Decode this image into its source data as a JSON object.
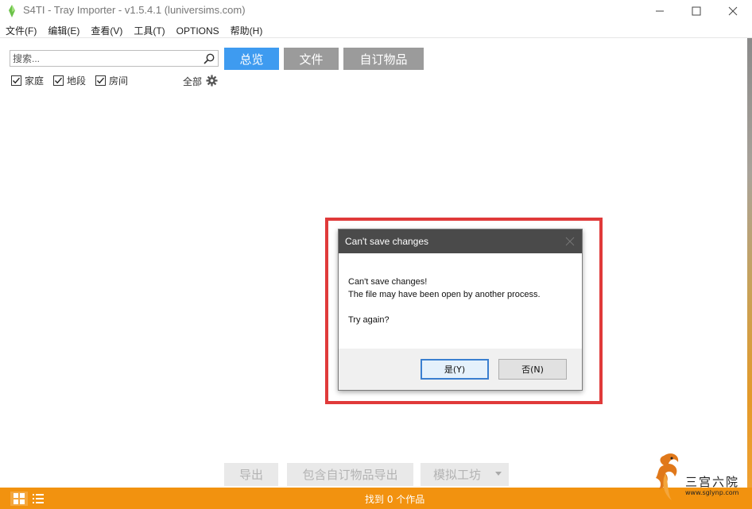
{
  "window": {
    "title": "S4TI - Tray Importer - v1.5.4.1  (luniversims.com)"
  },
  "menu": [
    "文件(F)",
    "编辑(E)",
    "查看(V)",
    "工具(T)",
    "OPTIONS",
    "帮助(H)"
  ],
  "search": {
    "placeholder": "搜索..."
  },
  "filters": {
    "items": [
      {
        "label": "家庭",
        "checked": true
      },
      {
        "label": "地段",
        "checked": true
      },
      {
        "label": "房间",
        "checked": true
      }
    ],
    "all_label": "全部"
  },
  "tabs": [
    {
      "label": "总览",
      "active": true
    },
    {
      "label": "文件",
      "active": false
    },
    {
      "label": "自订物品",
      "active": false
    }
  ],
  "dialog": {
    "title": "Can't save changes",
    "line1": "Can't save changes!",
    "line2": "The file may have been open by another process.",
    "line3": "Try again?",
    "yes_label": "是(Y)",
    "no_label": "否(N)"
  },
  "bottom_buttons": {
    "export": "导出",
    "export_cc": "包含自订物品导出",
    "workshop": "模拟工坊"
  },
  "status": {
    "text": "找到  0  个作品"
  },
  "watermark": {
    "text": "三宫六院",
    "url": "www.sglynp.com"
  },
  "colors": {
    "accent_blue": "#3e9bf0",
    "tab_inactive": "#9b9b9b",
    "status_orange": "#f2920f",
    "highlight_red": "#e03a3a",
    "dialog_title": "#4a4a4a"
  }
}
